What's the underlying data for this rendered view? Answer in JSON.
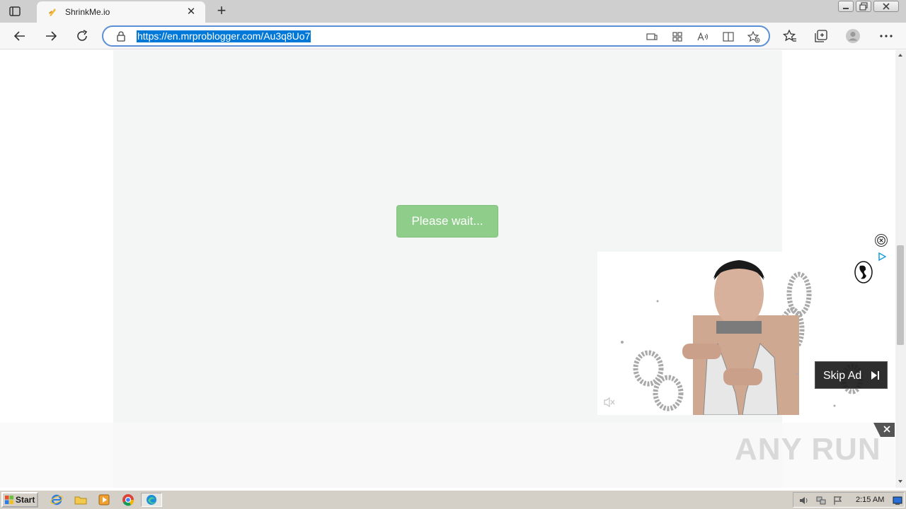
{
  "browser": {
    "tab_title": "ShrinkMe.io",
    "url": "https://en.mrproblogger.com/Au3q8Uo7"
  },
  "page": {
    "wait_button_label": "Please wait..."
  },
  "ad": {
    "skip_label": "Skip Ad",
    "icons": [
      "close-circle-icon",
      "adchoices-icon",
      "swan-logo-icon",
      "mute-icon",
      "skip-next-icon"
    ]
  },
  "watermark": "ANY RUN",
  "taskbar": {
    "start_label": "Start",
    "clock": "2:15 AM",
    "apps": [
      "internet-explorer-icon",
      "explorer-folder-icon",
      "media-player-icon",
      "chrome-icon",
      "edge-icon"
    ]
  },
  "colors": {
    "wait_button": "#8fce8a",
    "url_highlight": "#0078d7",
    "address_border": "#5c8fd6"
  }
}
